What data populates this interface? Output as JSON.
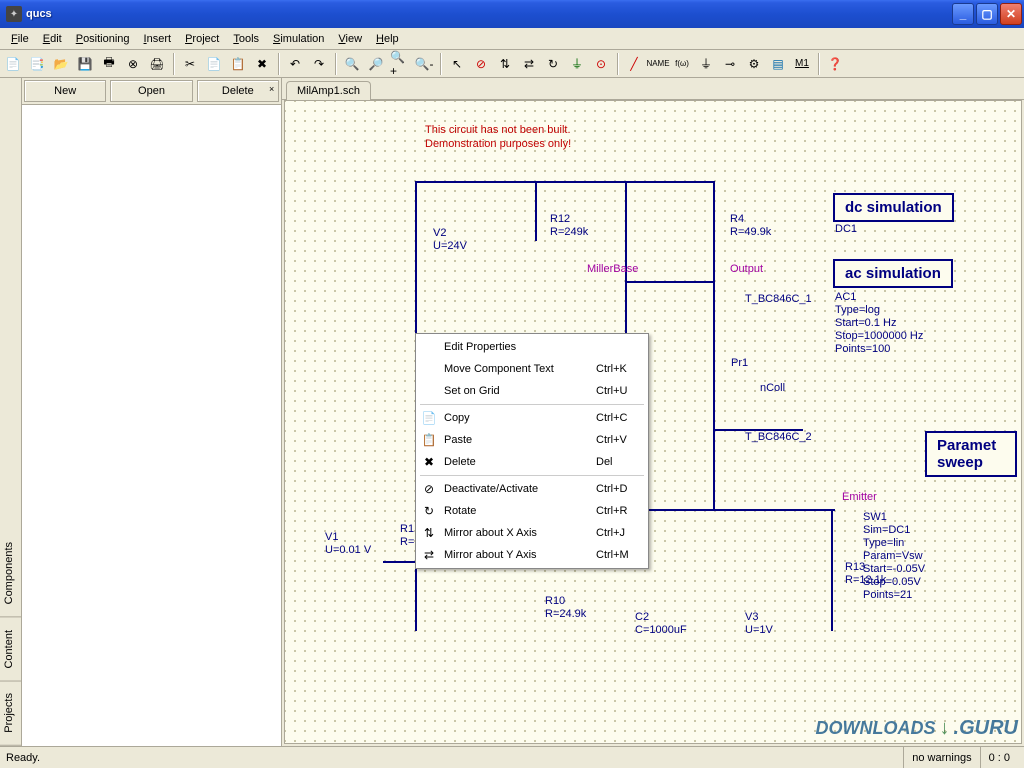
{
  "title": "qucs",
  "menus": [
    "File",
    "Edit",
    "Positioning",
    "Insert",
    "Project",
    "Tools",
    "Simulation",
    "View",
    "Help"
  ],
  "left": {
    "tabs": [
      "Projects",
      "Content",
      "Components"
    ],
    "buttons": [
      "New",
      "Open",
      "Delete"
    ]
  },
  "file_tab": "MilAmp1.sch",
  "warning_l1": "This circuit has not been built.",
  "warning_l2": "Demonstration purposes only!",
  "components": {
    "V2": {
      "name": "V2",
      "val": "U=24V"
    },
    "R12": {
      "name": "R12",
      "val": "R=249k"
    },
    "R4": {
      "name": "R4",
      "val": "R=49.9k"
    },
    "T1": "T_BC846C_1",
    "T2": "T_BC846C_2",
    "Pr1": "Pr1",
    "nColl": "nColl",
    "millerbase": "MillerBase",
    "output": "Output",
    "emitter": "Emitter",
    "V1": {
      "name": "V1",
      "val": "U=0.01 V"
    },
    "R1": {
      "name": "R1",
      "val": "R="
    },
    "R10": {
      "name": "R10",
      "val": "R=24.9k"
    },
    "C2": {
      "name": "C2",
      "val": "C=1000uF"
    },
    "R13": {
      "name": "R13",
      "val": "R=12.1k"
    },
    "V3": {
      "name": "V3",
      "val": "U=1V"
    }
  },
  "sim": {
    "dc": {
      "title": "dc simulation",
      "name": "DC1"
    },
    "ac": {
      "title": "ac simulation",
      "name": "AC1",
      "p1": "Type=log",
      "p2": "Start=0.1 Hz",
      "p3": "Stop=1000000 Hz",
      "p4": "Points=100"
    },
    "sw": {
      "title": "Paramet\nsweep",
      "name": "SW1",
      "p1": "Sim=DC1",
      "p2": "Type=lin",
      "p3": "Param=Vsw",
      "p4": "Start=-0.05V",
      "p5": "Stop=0.05V",
      "p6": "Points=21"
    }
  },
  "ctx": [
    {
      "icon": "",
      "label": "Edit Properties",
      "short": ""
    },
    {
      "icon": "",
      "label": "Move Component Text",
      "short": "Ctrl+K"
    },
    {
      "icon": "",
      "label": "Set on Grid",
      "short": "Ctrl+U"
    },
    {
      "sep": true
    },
    {
      "icon": "📄",
      "label": "Copy",
      "short": "Ctrl+C"
    },
    {
      "icon": "📋",
      "label": "Paste",
      "short": "Ctrl+V"
    },
    {
      "icon": "✖",
      "label": "Delete",
      "short": "Del"
    },
    {
      "sep": true
    },
    {
      "icon": "⊘",
      "label": "Deactivate/Activate",
      "short": "Ctrl+D"
    },
    {
      "icon": "↻",
      "label": "Rotate",
      "short": "Ctrl+R"
    },
    {
      "icon": "⇅",
      "label": "Mirror about X Axis",
      "short": "Ctrl+J"
    },
    {
      "icon": "⇄",
      "label": "Mirror about Y Axis",
      "short": "Ctrl+M"
    }
  ],
  "status": {
    "ready": "Ready.",
    "warn": "no warnings",
    "coord": "0 : 0"
  },
  "watermark": {
    "a": "DOWNLOADS",
    "b": ".GURU"
  }
}
